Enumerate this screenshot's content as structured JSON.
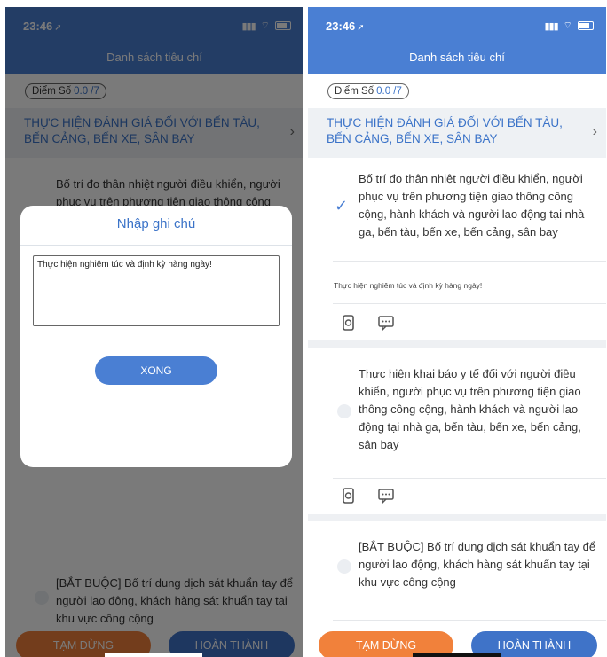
{
  "status_bar": {
    "time": "23:46",
    "location_arrow": "location-arrow-icon",
    "signal": "signal-icon",
    "wifi": "wifi-icon",
    "battery": "battery-icon"
  },
  "header": {
    "title": "Danh sách tiêu chí"
  },
  "score": {
    "label": "Điểm Số",
    "value": "0.0 /7"
  },
  "section": {
    "title": "THỰC HIỆN ĐÁNH GIÁ ĐỐI VỚI BẾN TÀU, BẾN CẢNG, BẾN XE, SÂN BAY",
    "chevron": "chevron-right-icon"
  },
  "items": [
    {
      "text": "Bố trí đo thân nhiệt người điều khiển, người phục vụ trên phương tiện giao thông công cộng, hành khách và người lao động tại nhà ga, bến tàu, bến xe, bến cảng, sân bay",
      "checked": true,
      "note": "Thực hiện nghiêm túc và định kỳ hàng ngày!"
    },
    {
      "text": "Thực hiện khai báo y tế đối với người điều khiển, người phục vụ trên phương tiện giao thông công cộng, hành khách và người lao động tại nhà ga, bến tàu, bến xe, bến cảng, sân bay",
      "checked": false
    },
    {
      "text": "[BẮT BUỘC] Bố trí dung dịch sát khuẩn tay để người lao động, khách hàng sát khuẩn tay tại khu vực công cộng",
      "checked": false
    }
  ],
  "item_tools": {
    "camera": "phone-camera-icon",
    "comment": "comment-icon"
  },
  "dialog": {
    "title": "Nhập ghi chú",
    "input_value": "Thực hiện nghiêm túc và định kỳ hàng ngày!",
    "confirm_label": "XONG"
  },
  "footer": {
    "pause_label": "TẠM DỪNG",
    "done_label": "HOÀN THÀNH"
  },
  "colors": {
    "primary": "#4a7fd3",
    "accent_orange": "#f1813b",
    "link_blue": "#3b73c8"
  }
}
